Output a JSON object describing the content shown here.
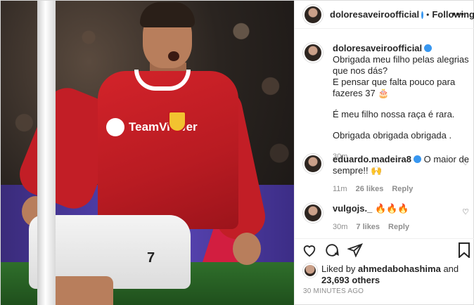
{
  "post": {
    "author": "doloresaveiroofficial",
    "follow_state": "Following",
    "separator": "•",
    "more_icon": "more-horizontal-icon"
  },
  "caption": {
    "username": "doloresaveiroofficial",
    "lines": [
      "Obrigada meu filho pelas alegrias que nos dás?",
      "E pensar que falta pouco para fazeres 37 🎂",
      "É meu filho nossa raça é rara.",
      "Obrigada obrigada obrigada ."
    ],
    "age": "30m"
  },
  "comments": [
    {
      "username": "eduardo.madeira8",
      "text": "O maior de sempre!! 🙌",
      "age": "11m",
      "likes": "26 likes",
      "reply": "Reply"
    },
    {
      "username": "vulgojs._",
      "text": "🔥🔥🔥",
      "age": "30m",
      "likes": "7 likes",
      "reply": "Reply"
    }
  ],
  "likes": {
    "prefix": "Liked by",
    "user": "ahmedabohashima",
    "joiner": "and",
    "count": "23,693 others"
  },
  "timestamp": "30 MINUTES AGO",
  "photo": {
    "sponsor_text": "TeamViewer",
    "shirt_number": "7"
  },
  "colors": {
    "verified": "#3897f0",
    "jersey_red": "#c21e26",
    "muted_text": "#8e8e8e"
  },
  "icons": [
    "heart-icon",
    "comment-icon",
    "share-icon",
    "bookmark-icon",
    "verified-badge-icon"
  ]
}
